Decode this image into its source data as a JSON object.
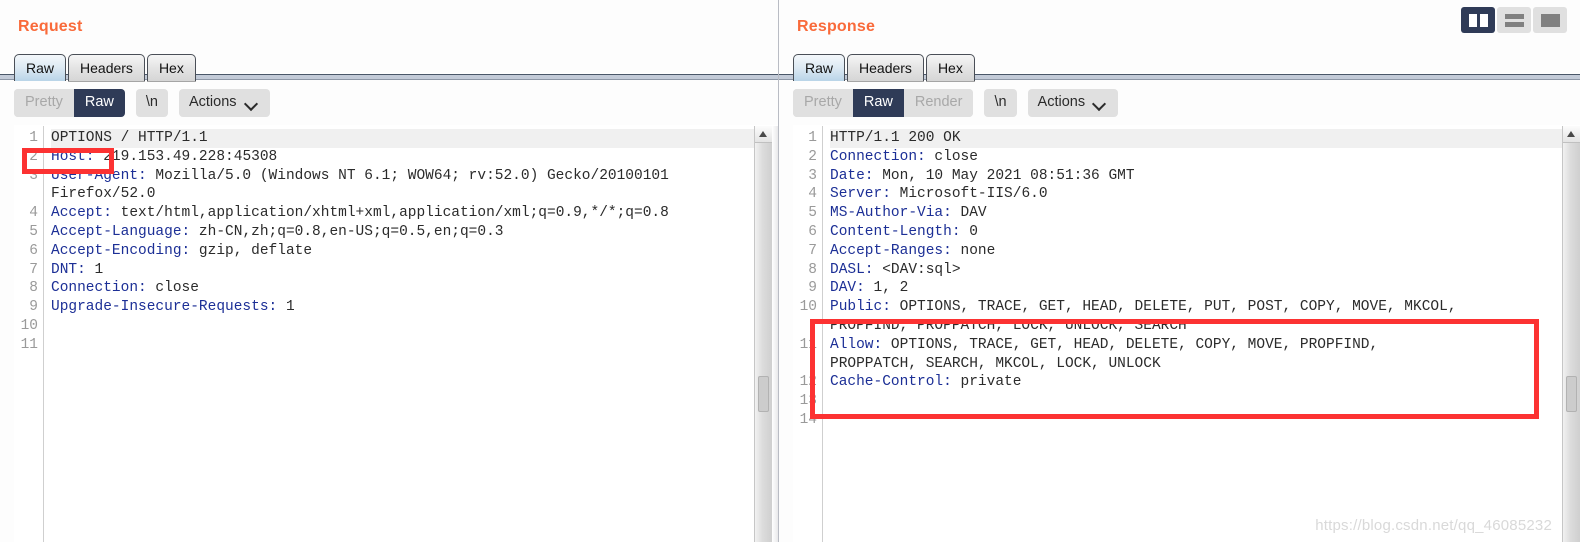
{
  "layout_buttons": [
    {
      "name": "side-by-side",
      "icon": "split-vertical-icon",
      "active": true
    },
    {
      "name": "stacked",
      "icon": "split-horizontal-icon",
      "active": false
    },
    {
      "name": "single",
      "icon": "single-pane-icon",
      "active": false
    }
  ],
  "watermark": "https://blog.csdn.net/qq_46085232",
  "request": {
    "title": "Request",
    "tabs": [
      {
        "label": "Raw",
        "active": true
      },
      {
        "label": "Headers",
        "active": false
      },
      {
        "label": "Hex",
        "active": false
      }
    ],
    "toolbar": {
      "pretty_label": "Pretty",
      "raw_label": "Raw",
      "newline_label": "\\n",
      "actions_label": "Actions",
      "active_view": "Raw"
    },
    "line_numbers": [
      "1",
      "2",
      "3",
      "",
      "4",
      "5",
      "6",
      "7",
      "8",
      "9",
      "10",
      "11"
    ],
    "lines": [
      {
        "num": "1",
        "header": "",
        "value": "OPTIONS / HTTP/1.1",
        "first": true
      },
      {
        "num": "2",
        "header": "Host:",
        "value": " 219.153.49.228:45308"
      },
      {
        "num": "3",
        "header": "User-Agent:",
        "value": " Mozilla/5.0 (Windows NT 6.1; WOW64; rv:52.0) Gecko/20100101"
      },
      {
        "num": "",
        "header": "",
        "value": "Firefox/52.0"
      },
      {
        "num": "4",
        "header": "Accept:",
        "value": " text/html,application/xhtml+xml,application/xml;q=0.9,*/*;q=0.8"
      },
      {
        "num": "5",
        "header": "Accept-Language:",
        "value": " zh-CN,zh;q=0.8,en-US;q=0.5,en;q=0.3"
      },
      {
        "num": "6",
        "header": "Accept-Encoding:",
        "value": " gzip, deflate"
      },
      {
        "num": "7",
        "header": "DNT:",
        "value": " 1"
      },
      {
        "num": "8",
        "header": "Connection:",
        "value": " close"
      },
      {
        "num": "9",
        "header": "Upgrade-Insecure-Requests:",
        "value": " 1"
      },
      {
        "num": "10",
        "header": "",
        "value": ""
      },
      {
        "num": "11",
        "header": "",
        "value": ""
      }
    ],
    "highlight": "OPTIONS"
  },
  "response": {
    "title": "Response",
    "tabs": [
      {
        "label": "Raw",
        "active": true
      },
      {
        "label": "Headers",
        "active": false
      },
      {
        "label": "Hex",
        "active": false
      }
    ],
    "toolbar": {
      "pretty_label": "Pretty",
      "raw_label": "Raw",
      "render_label": "Render",
      "newline_label": "\\n",
      "actions_label": "Actions",
      "active_view": "Raw"
    },
    "lines": [
      {
        "num": "1",
        "header": "",
        "value": "HTTP/1.1 200 OK",
        "first": true
      },
      {
        "num": "2",
        "header": "Connection:",
        "value": " close"
      },
      {
        "num": "3",
        "header": "Date:",
        "value": " Mon, 10 May 2021 08:51:36 GMT"
      },
      {
        "num": "4",
        "header": "Server:",
        "value": " Microsoft-IIS/6.0"
      },
      {
        "num": "5",
        "header": "MS-Author-Via:",
        "value": " DAV"
      },
      {
        "num": "6",
        "header": "Content-Length:",
        "value": " 0"
      },
      {
        "num": "7",
        "header": "Accept-Ranges:",
        "value": " none"
      },
      {
        "num": "8",
        "header": "DASL:",
        "value": " <DAV:sql>"
      },
      {
        "num": "9",
        "header": "DAV:",
        "value": " 1, 2"
      },
      {
        "num": "10",
        "header": "Public:",
        "value": " OPTIONS, TRACE, GET, HEAD, DELETE, PUT, POST, COPY, MOVE, MKCOL,"
      },
      {
        "num": "",
        "header": "",
        "value": "PROPFIND, PROPPATCH, LOCK, UNLOCK, SEARCH"
      },
      {
        "num": "11",
        "header": "Allow:",
        "value": " OPTIONS, TRACE, GET, HEAD, DELETE, COPY, MOVE, PROPFIND,"
      },
      {
        "num": "",
        "header": "",
        "value": "PROPPATCH, SEARCH, MKCOL, LOCK, UNLOCK"
      },
      {
        "num": "12",
        "header": "Cache-Control:",
        "value": " private"
      },
      {
        "num": "13",
        "header": "",
        "value": ""
      },
      {
        "num": "14",
        "header": "",
        "value": ""
      }
    ]
  },
  "colors": {
    "title": "#f96a3a",
    "header_key": "#1c2f96",
    "active_seg": "#2f3b57",
    "annotation": "#fc3232"
  }
}
